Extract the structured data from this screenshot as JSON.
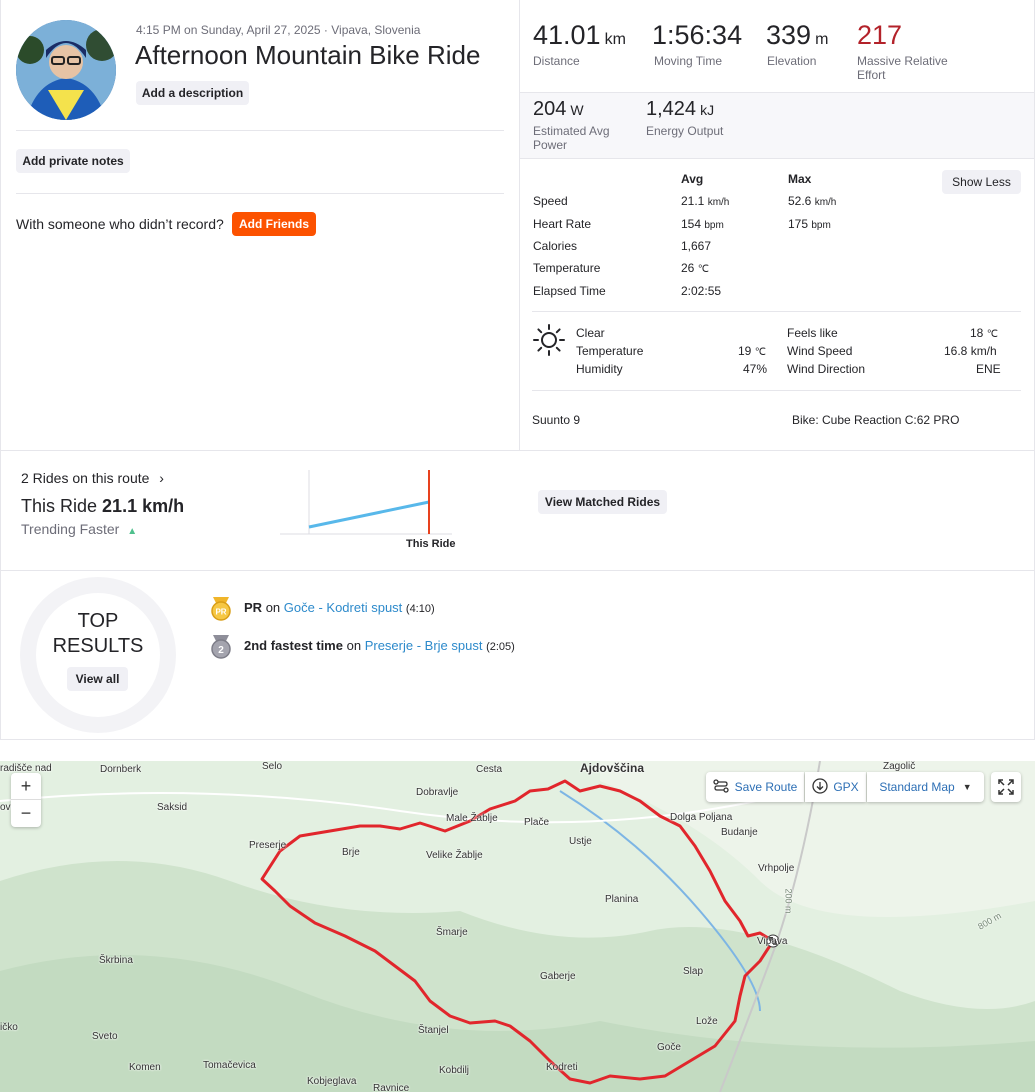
{
  "header": {
    "meta": "4:15 PM on Sunday, April 27, 2025 · Vipava, Slovenia",
    "title": "Afternoon Mountain Bike Ride",
    "add_description": "Add a description",
    "add_private_notes": "Add private notes",
    "with_someone": "With someone who didn’t record?",
    "add_friends": "Add Friends"
  },
  "stats": [
    {
      "value": "41.01",
      "unit": "km",
      "label": "Distance"
    },
    {
      "value": "1:56:34",
      "unit": "",
      "label": "Moving Time"
    },
    {
      "value": "339",
      "unit": "m",
      "label": "Elevation"
    },
    {
      "value": "217",
      "unit": "",
      "label": "Massive Relative Effort"
    }
  ],
  "stats2": [
    {
      "value": "204",
      "unit": "W",
      "label": "Estimated Avg Power"
    },
    {
      "value": "1,424",
      "unit": "kJ",
      "label": "Energy Output"
    }
  ],
  "details": {
    "avg_header": "Avg",
    "max_header": "Max",
    "show_less": "Show Less",
    "rows": [
      {
        "label": "Speed",
        "avg": "21.1",
        "avg_unit": "km/h",
        "max": "52.6",
        "max_unit": "km/h"
      },
      {
        "label": "Heart Rate",
        "avg": "154",
        "avg_unit": "bpm",
        "max": "175",
        "max_unit": "bpm"
      },
      {
        "label": "Calories",
        "avg": "1,667",
        "avg_unit": "",
        "max": "",
        "max_unit": ""
      },
      {
        "label": "Temperature",
        "avg": "26",
        "avg_unit": "℃",
        "max": "",
        "max_unit": ""
      },
      {
        "label": "Elapsed Time",
        "avg": "2:02:55",
        "avg_unit": "",
        "max": "",
        "max_unit": ""
      }
    ]
  },
  "weather": {
    "condition": "Clear",
    "temperature_label": "Temperature",
    "temperature": "19",
    "temperature_unit": "℃",
    "humidity_label": "Humidity",
    "humidity": "47%",
    "feels_like_label": "Feels like",
    "feels_like": "18",
    "feels_like_unit": "℃",
    "wind_speed_label": "Wind Speed",
    "wind_speed": "16.8 km/h",
    "wind_direction_label": "Wind Direction",
    "wind_direction": "ENE"
  },
  "gear": {
    "device": "Suunto 9",
    "bike": "Bike: Cube Reaction C:62 PRO"
  },
  "route": {
    "rides_on_route": "2 Rides on this route",
    "this_ride_prefix": "This Ride",
    "this_ride_speed": "21.1 km/h",
    "trend": "Trending Faster",
    "chart_marker_label": "This Ride",
    "view_matched": "View Matched Rides"
  },
  "top_results": {
    "title_line1": "TOP",
    "title_line2": "RESULTS",
    "view_all": "View all",
    "items": [
      {
        "badge": "PR",
        "prefix": "PR",
        "on": "on",
        "segment": "Goče - Kodreti spust",
        "time": "(4:10)"
      },
      {
        "badge": "2",
        "prefix": "2nd fastest time",
        "on": "on",
        "segment": "Preserje - Brje spust",
        "time": "(2:05)"
      }
    ]
  },
  "map": {
    "save_route": "Save Route",
    "gpx": "GPX",
    "map_type": "Standard Map",
    "zoom_in": "+",
    "zoom_out": "−",
    "elev_200": "200 m",
    "elev_800": "800 m",
    "places": [
      "Dornberk",
      "Selo",
      "Cesta",
      "Ajdovščina",
      "Zagolič",
      "Saksid",
      "Dobravlje",
      "Male Žablje",
      "Plače",
      "Dolga Poljana",
      "Budanje",
      "Preserje",
      "Brje",
      "Velike Žablje",
      "Ustje",
      "Vrhpolje",
      "Planina",
      "Šmarje",
      "Vipava",
      "Škrbina",
      "Gaberje",
      "Slap",
      "Sveto",
      "Štanjel",
      "Lože",
      "Goče",
      "Komen",
      "Tomačevica",
      "Kobdilj",
      "Kodreti",
      "Kobjeglava",
      "Ravnice",
      "ičko",
      "radišče nad",
      "ovi"
    ]
  }
}
